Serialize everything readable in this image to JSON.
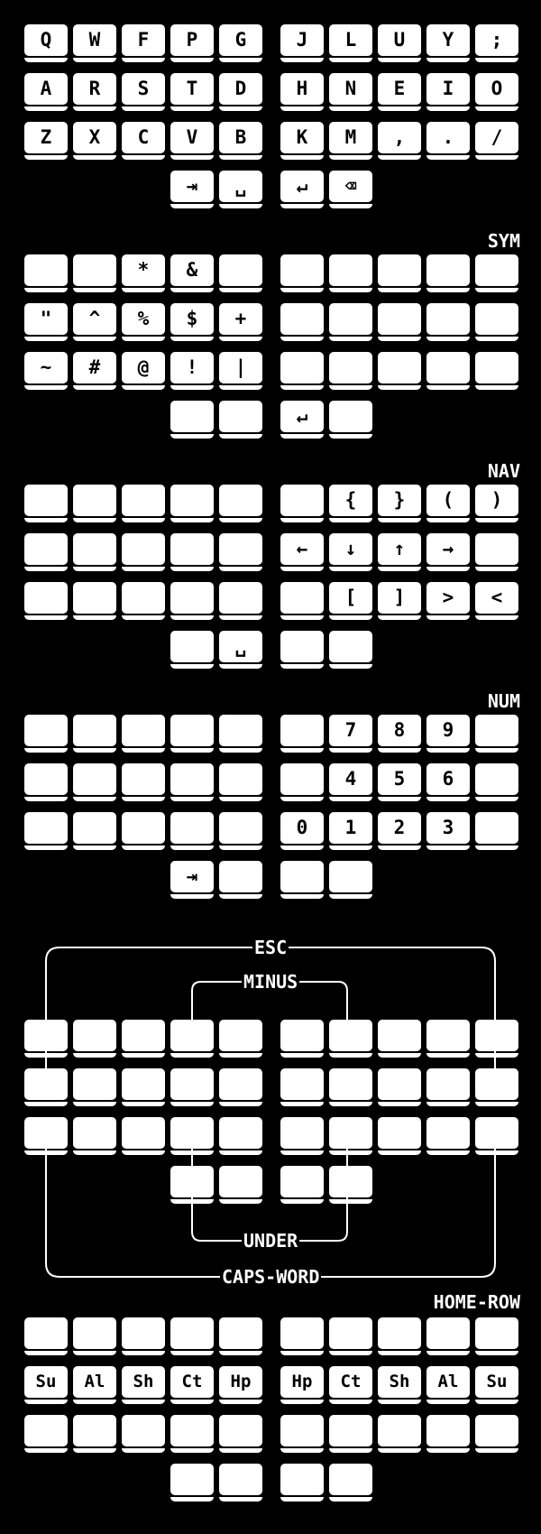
{
  "layers": [
    {
      "id": "base",
      "title": "",
      "rows": [
        [
          "Q",
          "W",
          "F",
          "P",
          "G",
          "J",
          "L",
          "U",
          "Y",
          ";"
        ],
        [
          "A",
          "R",
          "S",
          "T",
          "D",
          "H",
          "N",
          "E",
          "I",
          "O"
        ],
        [
          "Z",
          "X",
          "C",
          "V",
          "B",
          "K",
          "M",
          ",",
          ".",
          "/"
        ]
      ],
      "thumbs": [
        "⇥",
        "␣",
        "↵",
        "⌫"
      ]
    },
    {
      "id": "sym",
      "title": "SYM",
      "rows": [
        [
          "",
          "",
          "*",
          "&",
          "",
          "",
          "",
          "",
          "",
          ""
        ],
        [
          "\"",
          "^",
          "%",
          "$",
          "+",
          "",
          "",
          "",
          "",
          ""
        ],
        [
          "~",
          "#",
          "@",
          "!",
          "|",
          "",
          "",
          "",
          "",
          ""
        ]
      ],
      "thumbs": [
        "",
        "",
        "↵",
        ""
      ]
    },
    {
      "id": "nav",
      "title": "NAV",
      "rows": [
        [
          "",
          "",
          "",
          "",
          "",
          "",
          "{",
          "}",
          "(",
          ")"
        ],
        [
          "",
          "",
          "",
          "",
          "",
          "←",
          "↓",
          "↑",
          "→",
          ""
        ],
        [
          "",
          "",
          "",
          "",
          "",
          "",
          "[",
          "]",
          ">",
          "<"
        ]
      ],
      "thumbs": [
        "",
        "␣",
        "",
        ""
      ]
    },
    {
      "id": "num",
      "title": "NUM",
      "rows": [
        [
          "",
          "",
          "",
          "",
          "",
          "",
          "7",
          "8",
          "9",
          ""
        ],
        [
          "",
          "",
          "",
          "",
          "",
          "",
          "4",
          "5",
          "6",
          ""
        ],
        [
          "",
          "",
          "",
          "",
          "",
          "0",
          "1",
          "2",
          "3",
          ""
        ]
      ],
      "thumbs": [
        "⇥",
        "",
        "",
        ""
      ]
    },
    {
      "id": "combos",
      "title": "",
      "rows": [
        [
          "",
          "",
          "",
          "",
          "",
          "",
          "",
          "",
          "",
          ""
        ],
        [
          "",
          "",
          "",
          "",
          "",
          "",
          "",
          "",
          "",
          ""
        ],
        [
          "",
          "",
          "",
          "",
          "",
          "",
          "",
          "",
          "",
          ""
        ]
      ],
      "thumbs": [
        "",
        "",
        "",
        ""
      ]
    },
    {
      "id": "home-row",
      "title": "HOME-ROW",
      "rows": [
        [
          "",
          "",
          "",
          "",
          "",
          "",
          "",
          "",
          "",
          ""
        ],
        [
          "Su",
          "Al",
          "Sh",
          "Ct",
          "Hp",
          "Hp",
          "Ct",
          "Sh",
          "Al",
          "Su"
        ],
        [
          "",
          "",
          "",
          "",
          "",
          "",
          "",
          "",
          "",
          ""
        ]
      ],
      "thumbs": [
        "",
        "",
        "",
        ""
      ]
    }
  ],
  "combos": {
    "esc": "ESC",
    "minus": "MINUS",
    "under": "UNDER",
    "caps_word": "CAPS-WORD"
  }
}
